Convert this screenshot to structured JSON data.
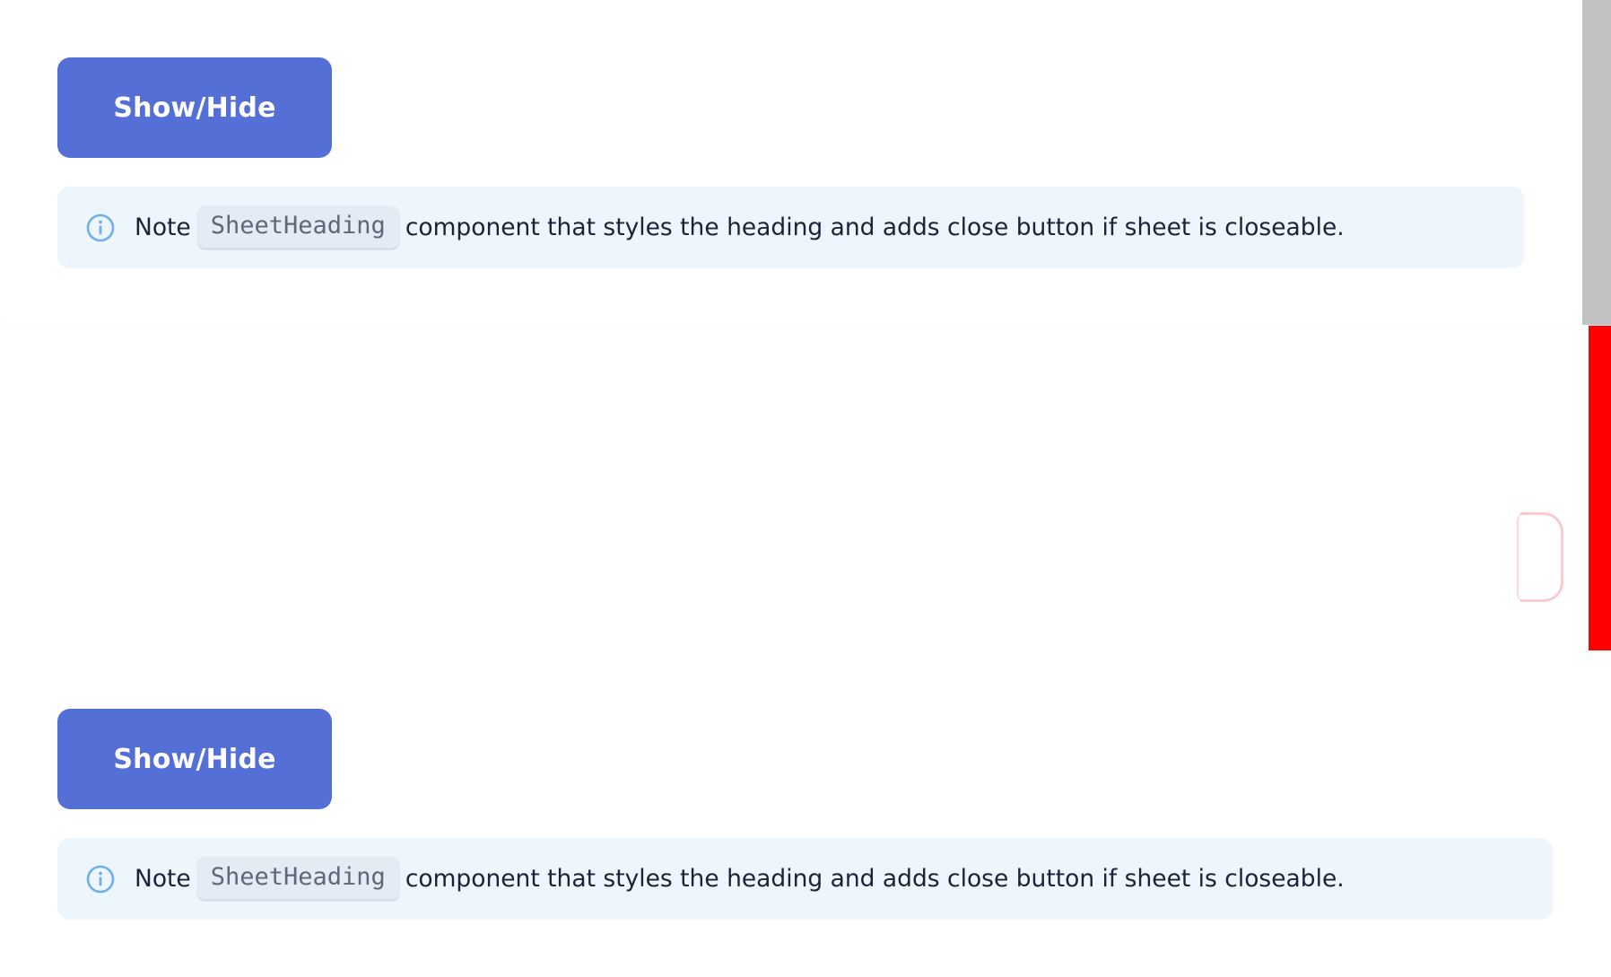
{
  "sections": [
    {
      "button_label": "Show/Hide",
      "note": {
        "icon": "info-icon",
        "lead": "Note",
        "code": "SheetHeading",
        "text": "component that styles the heading and adds close button if sheet is closeable."
      }
    },
    {
      "button_label": "Show/Hide",
      "note": {
        "icon": "info-icon",
        "lead": "Note",
        "code": "SheetHeading",
        "text": "component that styles the heading and adds close button if sheet is closeable."
      }
    }
  ],
  "colors": {
    "button": "#546fd6",
    "note_background": "#edf5fd",
    "info_icon": "#6fb0ea",
    "scrollbar_thumb": "#c2c2c2",
    "accent_red": "#ff0000"
  }
}
